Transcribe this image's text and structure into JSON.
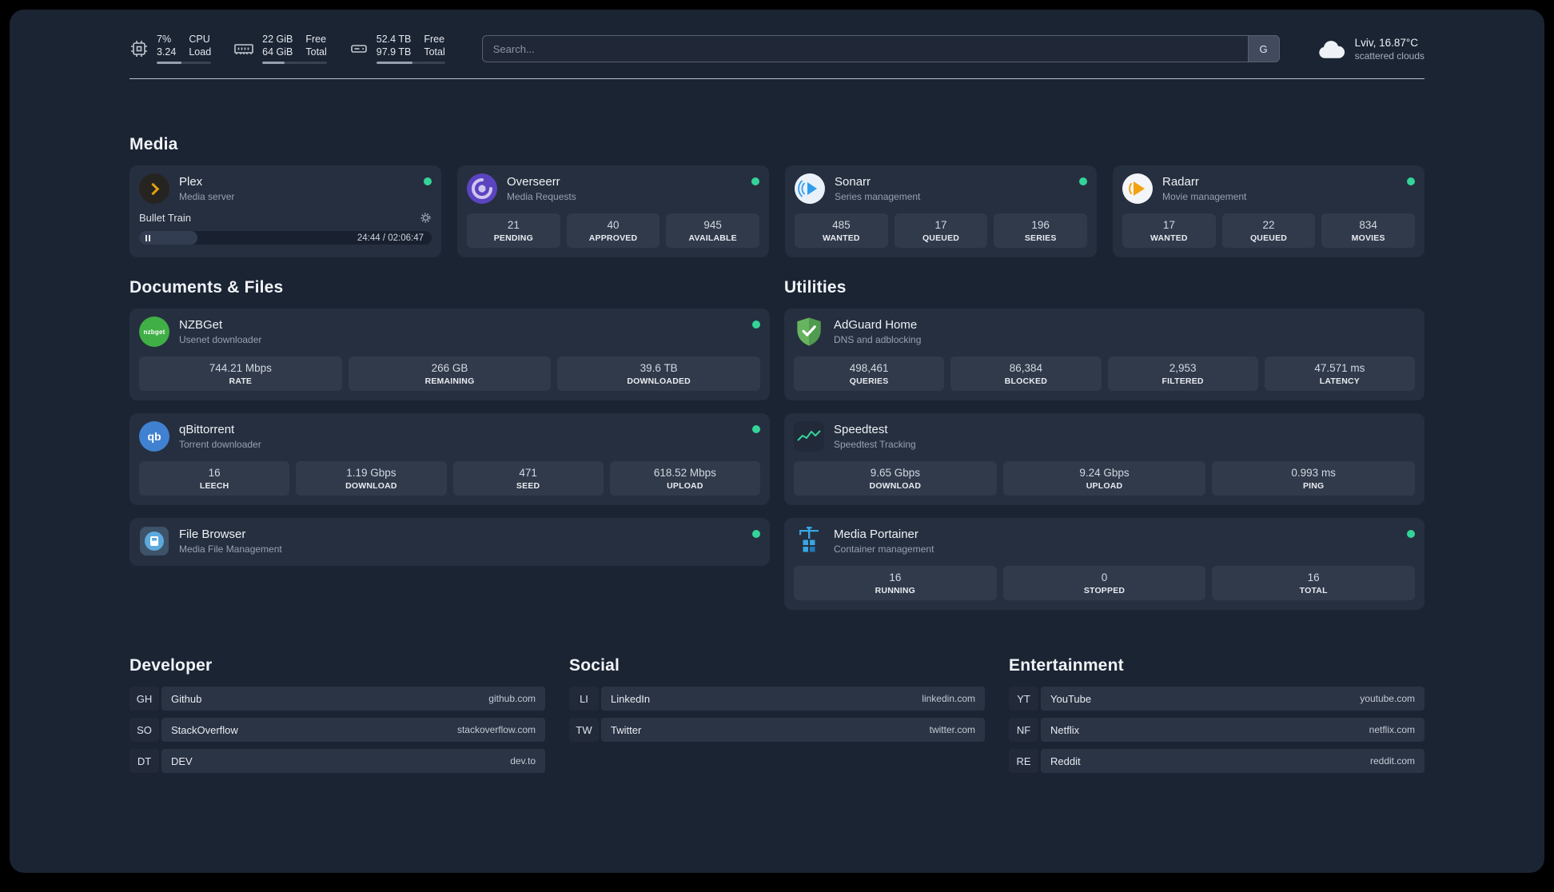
{
  "header": {
    "cpu": {
      "value1": "7%",
      "value2": "3.24",
      "label1": "CPU",
      "label2": "Load",
      "bar_percent": 45
    },
    "memory": {
      "value1": "22 GiB",
      "value2": "64 GiB",
      "label1": "Free",
      "label2": "Total",
      "bar_percent": 34
    },
    "disk": {
      "value1": "52.4 TB",
      "value2": "97.9 TB",
      "label1": "Free",
      "label2": "Total",
      "bar_percent": 53
    },
    "search": {
      "placeholder": "Search...",
      "button_label": "G"
    },
    "weather": {
      "location": "Lviv, 16.87°C",
      "condition": "scattered clouds"
    }
  },
  "media": {
    "title": "Media",
    "cards": [
      {
        "name": "Plex",
        "description": "Media server",
        "online": true,
        "player": {
          "track": "Bullet Train",
          "time": "24:44 / 02:06:47",
          "progress_percent": 20
        }
      },
      {
        "name": "Overseerr",
        "description": "Media Requests",
        "online": true,
        "stats": [
          {
            "value": "21",
            "label": "PENDING"
          },
          {
            "value": "40",
            "label": "APPROVED"
          },
          {
            "value": "945",
            "label": "AVAILABLE"
          }
        ]
      },
      {
        "name": "Sonarr",
        "description": "Series management",
        "online": true,
        "stats": [
          {
            "value": "485",
            "label": "WANTED"
          },
          {
            "value": "17",
            "label": "QUEUED"
          },
          {
            "value": "196",
            "label": "SERIES"
          }
        ]
      },
      {
        "name": "Radarr",
        "description": "Movie management",
        "online": true,
        "stats": [
          {
            "value": "17",
            "label": "WANTED"
          },
          {
            "value": "22",
            "label": "QUEUED"
          },
          {
            "value": "834",
            "label": "MOVIES"
          }
        ]
      }
    ]
  },
  "documents": {
    "title": "Documents & Files",
    "cards": [
      {
        "name": "NZBGet",
        "description": "Usenet downloader",
        "online": true,
        "icon_text": "nzbget",
        "stats": [
          {
            "value": "744.21 Mbps",
            "label": "RATE"
          },
          {
            "value": "266 GB",
            "label": "REMAINING"
          },
          {
            "value": "39.6 TB",
            "label": "DOWNLOADED"
          }
        ]
      },
      {
        "name": "qBittorrent",
        "description": "Torrent downloader",
        "online": true,
        "icon_text": "qb",
        "stats": [
          {
            "value": "16",
            "label": "LEECH"
          },
          {
            "value": "1.19 Gbps",
            "label": "DOWNLOAD"
          },
          {
            "value": "471",
            "label": "SEED"
          },
          {
            "value": "618.52 Mbps",
            "label": "UPLOAD"
          }
        ]
      },
      {
        "name": "File Browser",
        "description": "Media File Management",
        "online": true,
        "stats": []
      }
    ]
  },
  "utilities": {
    "title": "Utilities",
    "cards": [
      {
        "name": "AdGuard Home",
        "description": "DNS and adblocking",
        "stats": [
          {
            "value": "498,461",
            "label": "QUERIES"
          },
          {
            "value": "86,384",
            "label": "BLOCKED"
          },
          {
            "value": "2,953",
            "label": "FILTERED"
          },
          {
            "value": "47.571 ms",
            "label": "LATENCY"
          }
        ]
      },
      {
        "name": "Speedtest",
        "description": "Speedtest Tracking",
        "stats": [
          {
            "value": "9.65 Gbps",
            "label": "DOWNLOAD"
          },
          {
            "value": "9.24 Gbps",
            "label": "UPLOAD"
          },
          {
            "value": "0.993 ms",
            "label": "PING"
          }
        ]
      },
      {
        "name": "Media Portainer",
        "description": "Container management",
        "online": true,
        "stats": [
          {
            "value": "16",
            "label": "RUNNING"
          },
          {
            "value": "0",
            "label": "STOPPED"
          },
          {
            "value": "16",
            "label": "TOTAL"
          }
        ]
      }
    ]
  },
  "bookmarks": [
    {
      "title": "Developer",
      "items": [
        {
          "abbr": "GH",
          "name": "Github",
          "domain": "github.com"
        },
        {
          "abbr": "SO",
          "name": "StackOverflow",
          "domain": "stackoverflow.com"
        },
        {
          "abbr": "DT",
          "name": "DEV",
          "domain": "dev.to"
        }
      ]
    },
    {
      "title": "Social",
      "items": [
        {
          "abbr": "LI",
          "name": "LinkedIn",
          "domain": "linkedin.com"
        },
        {
          "abbr": "TW",
          "name": "Twitter",
          "domain": "twitter.com"
        }
      ]
    },
    {
      "title": "Entertainment",
      "items": [
        {
          "abbr": "YT",
          "name": "YouTube",
          "domain": "youtube.com"
        },
        {
          "abbr": "NF",
          "name": "Netflix",
          "domain": "netflix.com"
        },
        {
          "abbr": "RE",
          "name": "Reddit",
          "domain": "reddit.com"
        }
      ]
    }
  ],
  "colors": {
    "status_online": "#34d399",
    "page_background": "#1b2433",
    "card_background": "#262f3f",
    "accent_amber": "#e5a00d",
    "accent_green": "#3faf46"
  }
}
